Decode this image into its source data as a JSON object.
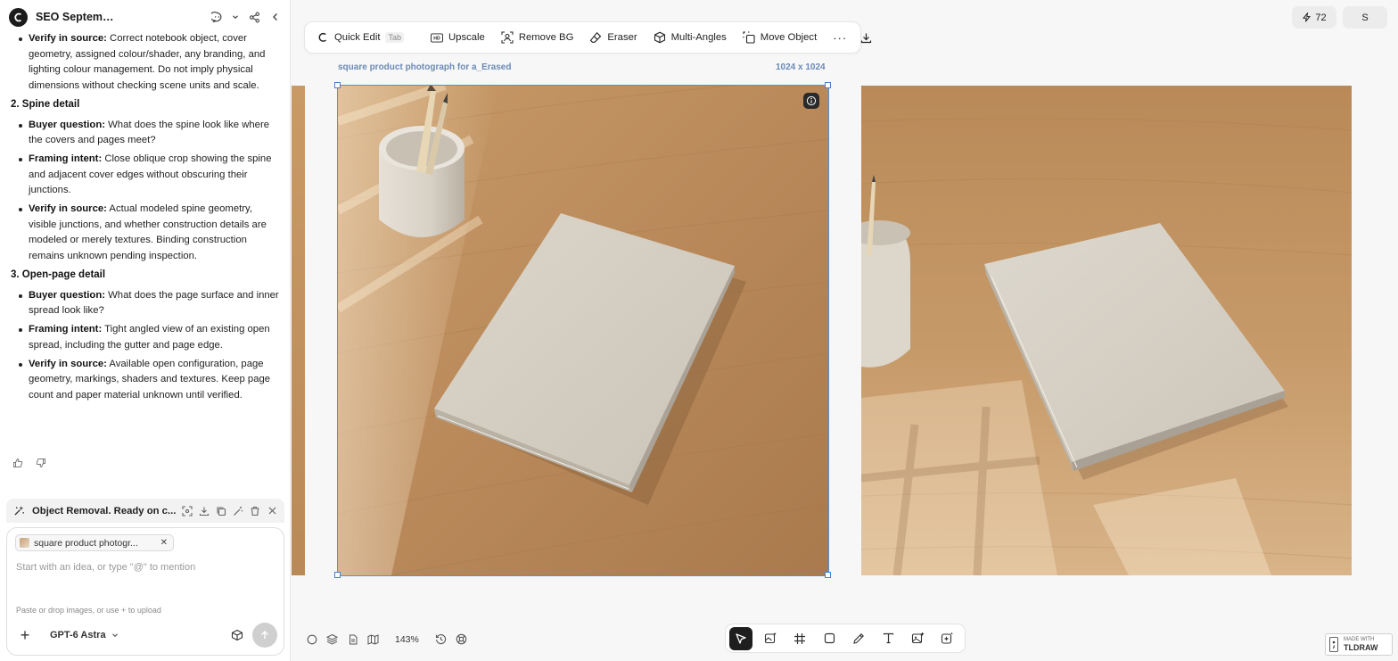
{
  "app": {
    "title": "SEO Septem…"
  },
  "sidebar": {
    "sections": {
      "intro_item": {
        "label": "Verify in source:",
        "text": "Correct notebook object, cover geometry, assigned colour/shader, any branding, and lighting colour management. Do not imply physical dimensions without checking scene units and scale."
      },
      "spine": {
        "heading": "2. Spine detail",
        "items": [
          {
            "label": "Buyer question:",
            "text": "What does the spine look like where the covers and pages meet?"
          },
          {
            "label": "Framing intent:",
            "text": "Close oblique crop showing the spine and adjacent cover edges without obscuring their junctions."
          },
          {
            "label": "Verify in source:",
            "text": "Actual modeled spine geometry, visible junctions, and whether construction details are modeled or merely textures. Binding construction remains unknown pending inspection."
          }
        ]
      },
      "open_page": {
        "heading": "3. Open-page detail",
        "items": [
          {
            "label": "Buyer question:",
            "text": "What does the page surface and inner spread look like?"
          },
          {
            "label": "Framing intent:",
            "text": "Tight angled view of an existing open spread, including the gutter and page edge."
          },
          {
            "label": "Verify in source:",
            "text": "Available open configuration, page geometry, markings, shaders and textures. Keep page count and paper material unknown until verified."
          }
        ]
      }
    },
    "task": {
      "title": "Object Removal. Ready on c..."
    },
    "composer": {
      "chip_label": "square product photogr...",
      "chip_close": "✕",
      "placeholder": "Start with an idea, or type \"@\" to mention",
      "hint": "Paste or drop images, or use + to upload",
      "plus": "+",
      "model": "GPT-6 Astra"
    }
  },
  "toolbar": {
    "items": [
      {
        "label": "Quick Edit",
        "tag": "Tab"
      },
      {
        "label": "Upscale"
      },
      {
        "label": "Remove BG"
      },
      {
        "label": "Eraser"
      },
      {
        "label": "Multi-Angles"
      },
      {
        "label": "Move Object"
      }
    ],
    "more": "···"
  },
  "topright": {
    "credits": "72",
    "avatar": "S"
  },
  "canvas": {
    "image_label": "square product photograph for a_Erased",
    "image_dims": "1024 x 1024"
  },
  "bottom": {
    "zoom": "143%"
  },
  "watermark": {
    "made": "MADE WITH",
    "brand": "TLDRAW"
  },
  "colors": {
    "selection": "#5b8dd6",
    "label": "#6b8ab5",
    "active_tool": "#1e1e1e"
  }
}
